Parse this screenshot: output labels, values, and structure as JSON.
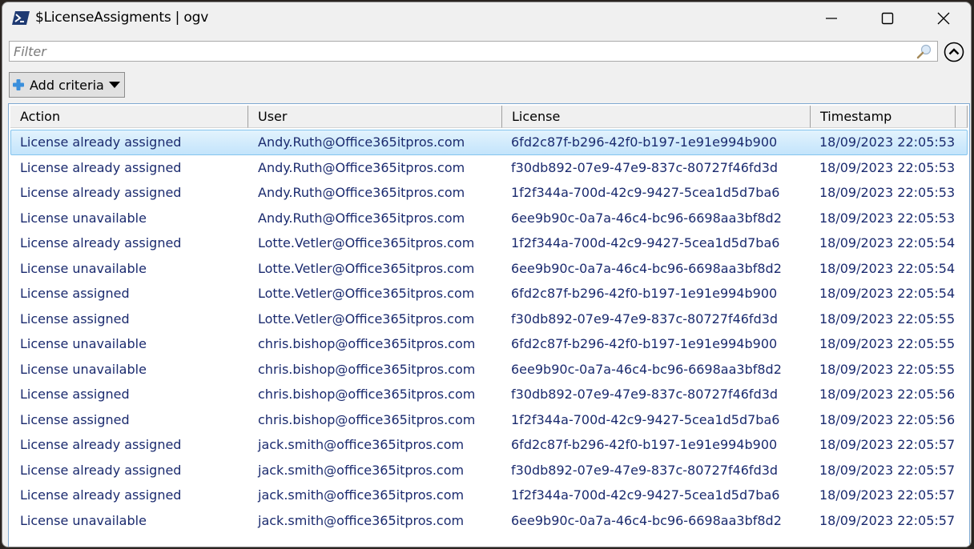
{
  "window": {
    "title": "$LicenseAssigments | ogv",
    "icon": "powershell-icon",
    "controls": [
      "minimize-icon",
      "maximize-icon",
      "close-icon"
    ]
  },
  "filter": {
    "placeholder": "Filter",
    "value": "",
    "search_icon": "search-icon",
    "collapse_icon": "chevron-up-circle-icon"
  },
  "toolbar": {
    "add_criteria_label": "Add criteria",
    "add_criteria_icon": "plus-icon"
  },
  "table": {
    "columns": [
      "Action",
      "User",
      "License",
      "Timestamp"
    ],
    "selected_row": 0,
    "rows": [
      [
        "License already assigned",
        "Andy.Ruth@Office365itpros.com",
        "6fd2c87f-b296-42f0-b197-1e91e994b900",
        "18/09/2023 22:05:53"
      ],
      [
        "License already assigned",
        "Andy.Ruth@Office365itpros.com",
        "f30db892-07e9-47e9-837c-80727f46fd3d",
        "18/09/2023 22:05:53"
      ],
      [
        "License already assigned",
        "Andy.Ruth@Office365itpros.com",
        "1f2f344a-700d-42c9-9427-5cea1d5d7ba6",
        "18/09/2023 22:05:53"
      ],
      [
        "License unavailable",
        "Andy.Ruth@Office365itpros.com",
        "6ee9b90c-0a7a-46c4-bc96-6698aa3bf8d2",
        "18/09/2023 22:05:53"
      ],
      [
        "License already assigned",
        "Lotte.Vetler@Office365itpros.com",
        "1f2f344a-700d-42c9-9427-5cea1d5d7ba6",
        "18/09/2023 22:05:54"
      ],
      [
        "License unavailable",
        "Lotte.Vetler@Office365itpros.com",
        "6ee9b90c-0a7a-46c4-bc96-6698aa3bf8d2",
        "18/09/2023 22:05:54"
      ],
      [
        "License assigned",
        "Lotte.Vetler@Office365itpros.com",
        "6fd2c87f-b296-42f0-b197-1e91e994b900",
        "18/09/2023 22:05:54"
      ],
      [
        "License assigned",
        "Lotte.Vetler@Office365itpros.com",
        "f30db892-07e9-47e9-837c-80727f46fd3d",
        "18/09/2023 22:05:55"
      ],
      [
        "License unavailable",
        "chris.bishop@office365itpros.com",
        "6fd2c87f-b296-42f0-b197-1e91e994b900",
        "18/09/2023 22:05:55"
      ],
      [
        "License unavailable",
        "chris.bishop@office365itpros.com",
        "6ee9b90c-0a7a-46c4-bc96-6698aa3bf8d2",
        "18/09/2023 22:05:55"
      ],
      [
        "License assigned",
        "chris.bishop@office365itpros.com",
        "f30db892-07e9-47e9-837c-80727f46fd3d",
        "18/09/2023 22:05:56"
      ],
      [
        "License assigned",
        "chris.bishop@office365itpros.com",
        "1f2f344a-700d-42c9-9427-5cea1d5d7ba6",
        "18/09/2023 22:05:56"
      ],
      [
        "License already assigned",
        "jack.smith@office365itpros.com",
        "6fd2c87f-b296-42f0-b197-1e91e994b900",
        "18/09/2023 22:05:57"
      ],
      [
        "License already assigned",
        "jack.smith@office365itpros.com",
        "f30db892-07e9-47e9-837c-80727f46fd3d",
        "18/09/2023 22:05:57"
      ],
      [
        "License already assigned",
        "jack.smith@office365itpros.com",
        "1f2f344a-700d-42c9-9427-5cea1d5d7ba6",
        "18/09/2023 22:05:57"
      ],
      [
        "License unavailable",
        "jack.smith@office365itpros.com",
        "6ee9b90c-0a7a-46c4-bc96-6698aa3bf8d2",
        "18/09/2023 22:05:57"
      ]
    ]
  },
  "colors": {
    "row_text": "#1a2a6e",
    "selection": "#c3e4fb",
    "selection_border": "#84c4ee"
  }
}
